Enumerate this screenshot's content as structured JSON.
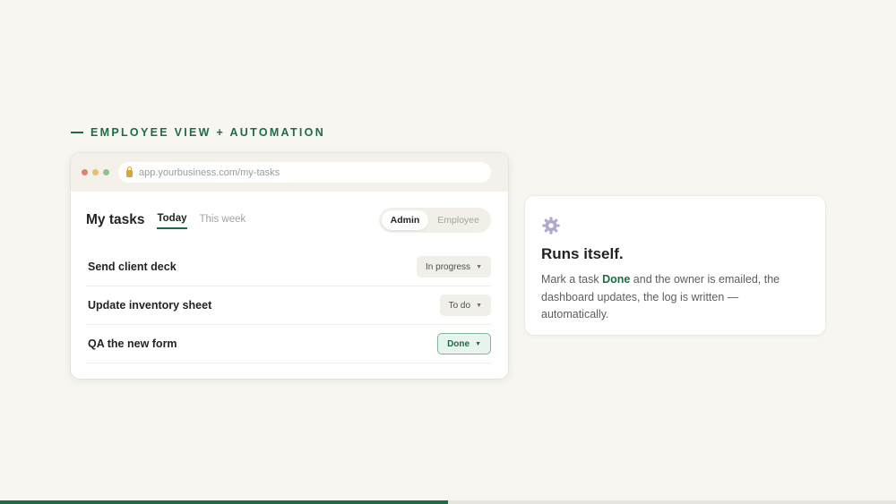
{
  "eyebrow": "EMPLOYEE VIEW + AUTOMATION",
  "browser": {
    "url": "app.yourbusiness.com/my-tasks"
  },
  "tasks": {
    "title": "My tasks",
    "tabs": [
      {
        "label": "Today",
        "active": true
      },
      {
        "label": "This week",
        "active": false
      }
    ],
    "view_toggle": [
      "Admin",
      "Employee"
    ],
    "view_selected": "Admin",
    "rows": [
      {
        "name": "Send client deck",
        "status": "In progress"
      },
      {
        "name": "Update inventory sheet",
        "status": "To do"
      },
      {
        "name": "QA the new form",
        "status": "Done"
      }
    ]
  },
  "card": {
    "icon": "gear-icon",
    "title": "Runs itself.",
    "body_before": "Mark a task ",
    "body_highlight": "Done",
    "body_after": " and the owner is emailed, the dashboard updates, the log is written — automatically."
  },
  "progress": 0.5,
  "colors": {
    "accent": "#1e6b47",
    "background": "#f7f6f1"
  }
}
